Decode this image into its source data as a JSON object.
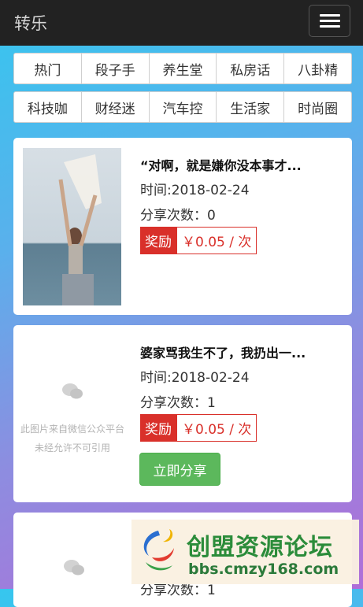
{
  "app": {
    "title": "转乐"
  },
  "categories_row1": [
    "热门",
    "段子手",
    "养生堂",
    "私房话",
    "八卦精"
  ],
  "categories_row2": [
    "科技咖",
    "财经迷",
    "汽车控",
    "生活家",
    "时尚圈"
  ],
  "articles": [
    {
      "title": "“对啊，就是嫌你没本事才...",
      "time": "时间:2018-02-24",
      "shares": "分享次数：0",
      "reward_label": "奖励",
      "reward_amount": "￥0.05 / 次"
    },
    {
      "title": "婆家骂我生不了，我扔出一...",
      "time": "时间:2018-02-24",
      "shares": "分享次数：1",
      "reward_label": "奖励",
      "reward_amount": "￥0.05 / 次",
      "placeholder_line1": "此图片来自微信公众平台",
      "placeholder_line2": "未经允许不可引用",
      "share_button": "立即分享"
    },
    {
      "shares_partial": "分享次数：1"
    }
  ],
  "watermark": {
    "title": "创盟资源论坛",
    "url": "bbs.cmzy168.com"
  },
  "colors": {
    "navbar": "#222222",
    "reward": "#d9302a",
    "share": "#5cb85c"
  }
}
